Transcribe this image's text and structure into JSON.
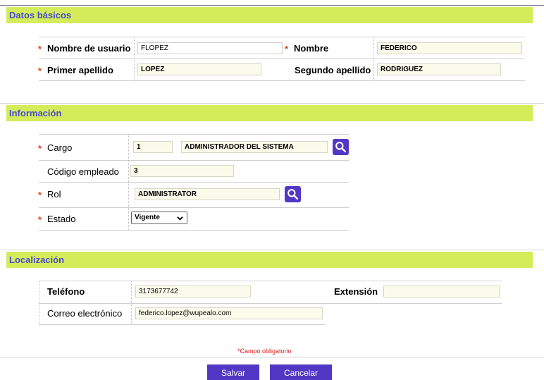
{
  "sections": {
    "basic": {
      "title": "Datos básicos"
    },
    "info": {
      "title": "Información"
    },
    "location": {
      "title": "Localización"
    }
  },
  "basic": {
    "username": {
      "label": "Nombre de usuario",
      "value": "FLOPEZ"
    },
    "name": {
      "label": "Nombre",
      "value": "FEDERICO"
    },
    "first_surname": {
      "label": "Primer apellido",
      "value": "LOPEZ"
    },
    "second_surname": {
      "label": "Segundo apellido",
      "value": "RODRIGUEZ"
    }
  },
  "info": {
    "position": {
      "label": "Cargo",
      "code": "1",
      "value": "ADMINISTRADOR DEL SISTEMA"
    },
    "employee_code": {
      "label": "Código empleado",
      "value": "3"
    },
    "role": {
      "label": "Rol",
      "value": "ADMINISTRATOR"
    },
    "status": {
      "label": "Estado",
      "selected": "Vigente"
    }
  },
  "location": {
    "phone": {
      "label": "Teléfono",
      "value": "3173677742"
    },
    "extension": {
      "label": "Extensión",
      "value": ""
    },
    "email": {
      "label": "Correo electrónico",
      "value": "federico.lopez@wupealo.com"
    }
  },
  "required_mark": "*",
  "required_note": "*Campo obligatorio",
  "buttons": {
    "save": "Salvar",
    "cancel": "Cancelar"
  },
  "icons": {
    "search": "search-icon",
    "dropdown": "chevron-down-icon"
  },
  "colors": {
    "section_bar": "#d4ec5a",
    "section_title": "#4b4bcc",
    "button": "#5038c4",
    "required": "#e0441a"
  }
}
